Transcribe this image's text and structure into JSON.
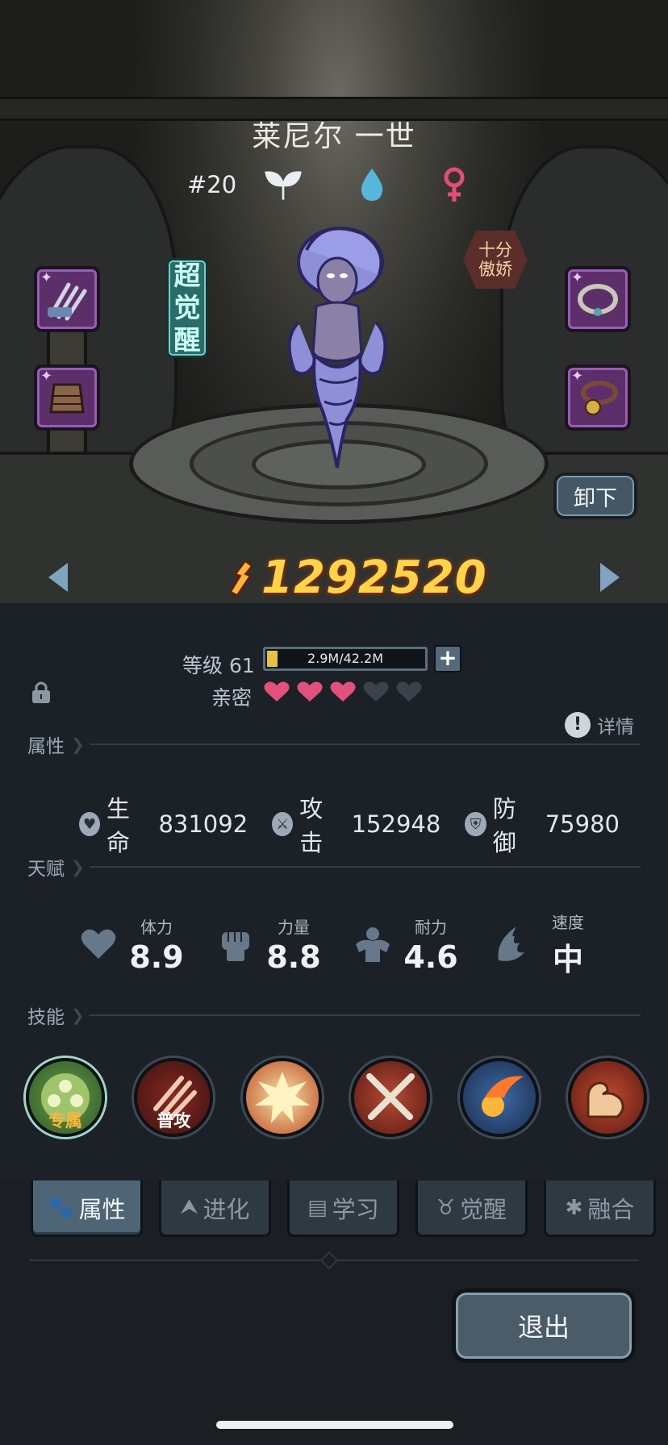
{
  "pet": {
    "name": "莱尼尔 一世",
    "rank": "#20",
    "traits": [
      "leaf-icon",
      "water-drop-icon",
      "female-icon"
    ],
    "awaken_badge": [
      "超",
      "觉",
      "醒"
    ],
    "personality": [
      "十分",
      "傲娇"
    ],
    "power": "1292520"
  },
  "buttons": {
    "unequip": "卸下",
    "exit": "退出"
  },
  "equipment": {
    "left": [
      "claw-weapon-icon",
      "armor-icon"
    ],
    "right": [
      "collar-icon",
      "bell-collar-icon"
    ]
  },
  "level": {
    "label": "等级 61",
    "xp_text": "2.9M/42.2M",
    "xp_progress": 0.069
  },
  "intimacy": {
    "label": "亲密",
    "filled": 3,
    "total": 5
  },
  "detail_label": "详情",
  "sections": {
    "attributes": "属性",
    "talent": "天赋",
    "skills": "技能"
  },
  "stats": [
    {
      "icon": "heart-shield-icon",
      "label": "生命",
      "value": "831092"
    },
    {
      "icon": "sword-icon",
      "label": "攻击",
      "value": "152948"
    },
    {
      "icon": "shield-icon",
      "label": "防御",
      "value": "75980"
    }
  ],
  "talents": [
    {
      "icon": "heart-icon",
      "label": "体力",
      "value": "8.9"
    },
    {
      "icon": "fist-icon",
      "label": "力量",
      "value": "8.8"
    },
    {
      "icon": "muscle-torso-icon",
      "label": "耐力",
      "value": "4.6"
    },
    {
      "icon": "wing-icon",
      "label": "速度",
      "value": "中"
    }
  ],
  "skills": [
    {
      "icon": "exclusive-skill-icon",
      "tag": "专属"
    },
    {
      "icon": "claw-slash-icon",
      "tag": "普攻"
    },
    {
      "icon": "explosion-icon",
      "tag": ""
    },
    {
      "icon": "crossed-swords-icon",
      "tag": ""
    },
    {
      "icon": "fireball-icon",
      "tag": ""
    },
    {
      "icon": "flex-arm-icon",
      "tag": ""
    }
  ],
  "tabs": [
    {
      "icon": "paw-icon",
      "label": "属性",
      "active": true
    },
    {
      "icon": "evolve-arrow-icon",
      "label": "进化",
      "active": false
    },
    {
      "icon": "book-icon",
      "label": "学习",
      "active": false
    },
    {
      "icon": "horned-head-icon",
      "label": "觉醒",
      "active": false
    },
    {
      "icon": "merge-icon",
      "label": "融合",
      "active": false
    }
  ],
  "colors": {
    "power": "#ffd34a",
    "heart_filled": "#e2517a",
    "heart_empty": "#3a434c",
    "active_tab": "#4d6574"
  }
}
